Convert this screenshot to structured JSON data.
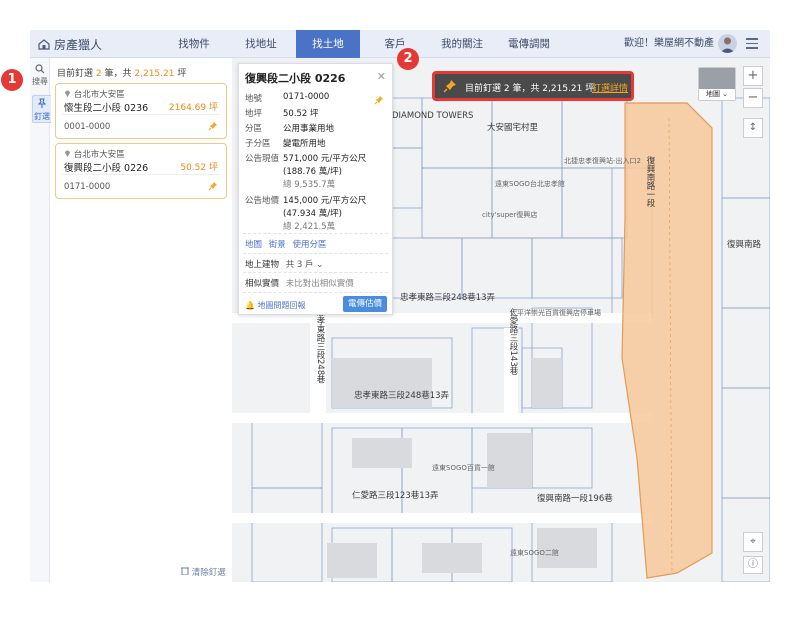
{
  "nav": {
    "brand": "房產獵人",
    "items": [
      {
        "label": "找物件",
        "active": false
      },
      {
        "label": "找地址",
        "active": false
      },
      {
        "label": "找土地",
        "active": true
      },
      {
        "label": "客戶",
        "active": false
      },
      {
        "label": "我的關注",
        "active": false
      },
      {
        "label": "電傳調閱",
        "active": false
      }
    ],
    "welcome": "歡迎！樂屋網不動產"
  },
  "rail": {
    "search_label": "搜尋",
    "pin_label": "釘選"
  },
  "pinlist": {
    "summary_prefix": "目前釘選",
    "summary_count": "2",
    "summary_mid": "筆，共",
    "summary_area": "2,215.21",
    "summary_unit": "坪",
    "cards": [
      {
        "district": "台北市大安區",
        "name": "懷生段二小段 0236",
        "area": "2164.69 坪",
        "code": "0001-0000"
      },
      {
        "district": "台北市大安區",
        "name": "復興段二小段 0226",
        "area": "50.52 坪",
        "code": "0171-0000"
      }
    ],
    "clear_label": "清除釘選"
  },
  "detail": {
    "title": "復興段二小段 0226",
    "rows": [
      {
        "k": "地號",
        "v": "0171-0000"
      },
      {
        "k": "地坪",
        "v": "50.52 坪"
      },
      {
        "k": "分區",
        "v": "公用事業用地"
      },
      {
        "k": "子分區",
        "v": "變電所用地"
      },
      {
        "k": "公告現值",
        "v": "571,000 元/平方公尺",
        "v2": "(188.76 萬/坪)",
        "v3": "總 9,535.7萬"
      },
      {
        "k": "公告地價",
        "v": "145,000 元/平方公尺",
        "v2": "(47.934 萬/坪)",
        "v3": "總 2,421.5萬"
      }
    ],
    "links": [
      "地圖",
      "街景",
      "使用分區"
    ],
    "building_label": "地上建物",
    "building_value": "共 3 戶",
    "price_label": "相似實價",
    "price_value": "未比對出相似實價",
    "report_label": "地圖問題回報",
    "action_label": "電傳估價"
  },
  "banner": {
    "text": "目前釘選 2 筆，共 2,215.21 坪",
    "link": "釘選詳情"
  },
  "map": {
    "thumb_label": "地圖",
    "labels": {
      "diamond": "DIAMOND TOWERS",
      "daan_village": "大安國宅村里",
      "sogo_north": "北捷忠孝復興站-出入口2",
      "sogo_jp": "遠東SOGO台北忠孝館",
      "cityfeel": "city'super復興店",
      "fuxing_s_rd": "復興南路一段",
      "fuxing_rd2": "復興南路",
      "lane248": "忠孝東路三段248巷13弄",
      "lane248v": "忠孝東路三段248巷",
      "lane248b": "忠孝東路三段248巷13弄",
      "lane143": "仁愛路三段143巷",
      "renai123": "仁愛路三段123巷13弄",
      "fuxing196": "復興南路一段196巷",
      "sogo_hall": "遠東SOGO二館",
      "sogo_store": "遠東SOGO百貨一館",
      "taipei_green": "台中市政府附近",
      "taiping": "太平洋崇光百貨復興店停車場"
    }
  },
  "badges": [
    "1",
    "2"
  ],
  "colors": {
    "accent": "#4a73c7",
    "orange": "#e88a1a",
    "highlight_fill": "#f7c89a",
    "badge": "#e53935"
  }
}
